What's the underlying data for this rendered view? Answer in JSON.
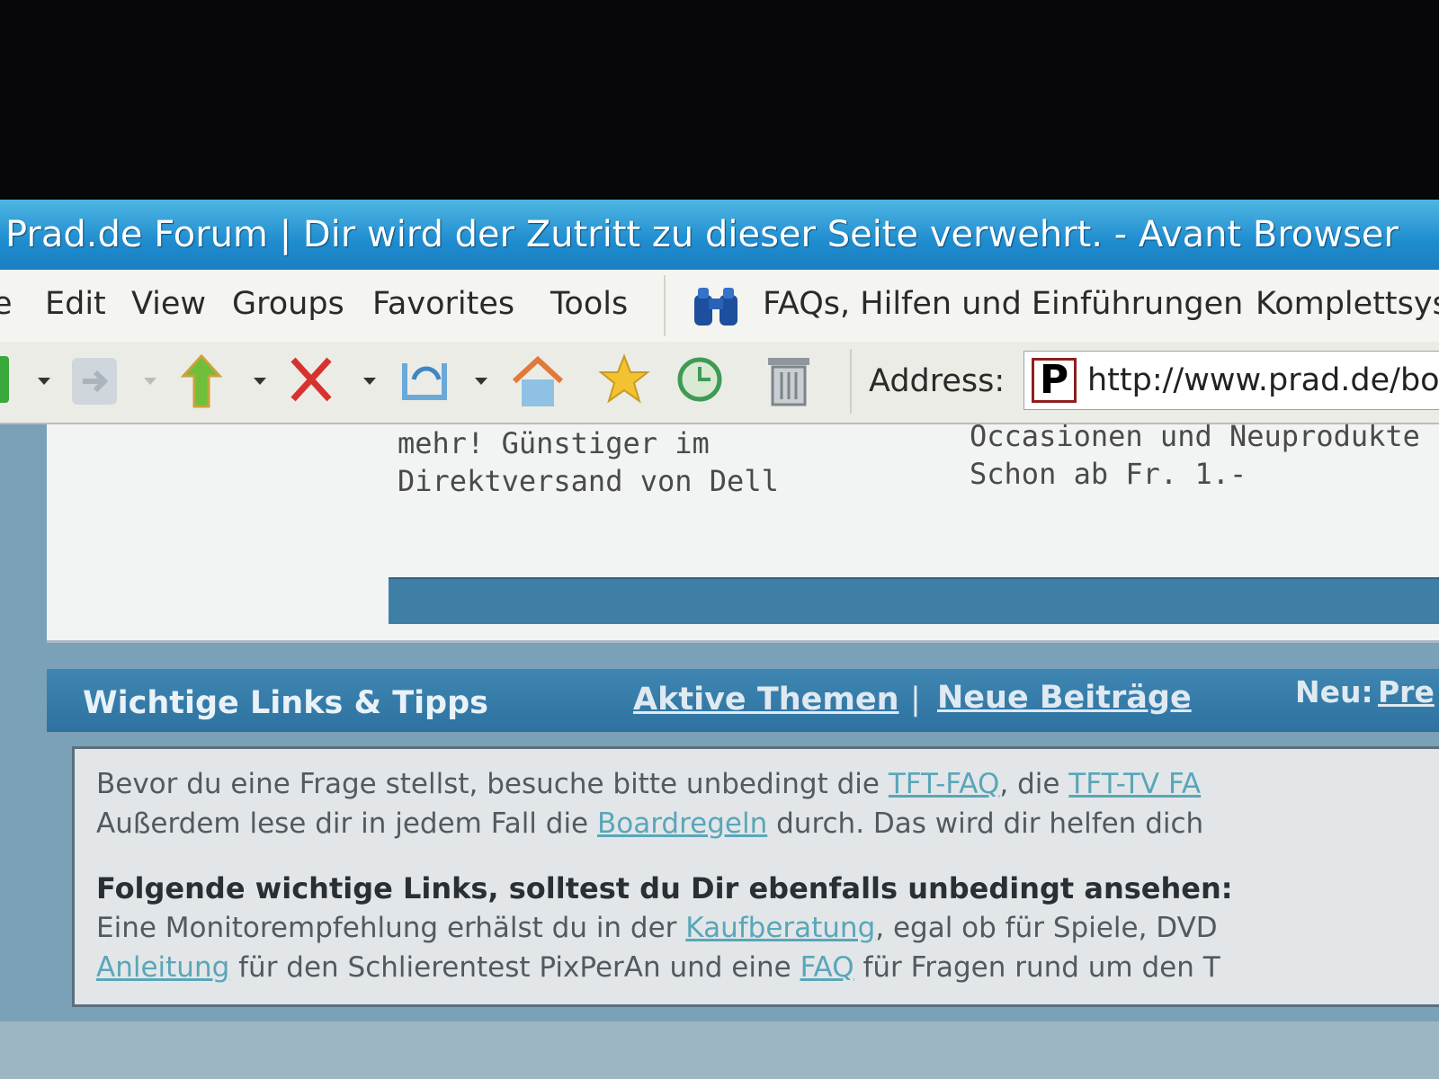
{
  "window": {
    "title": "Prad.de Forum | Dir wird der Zutritt zu dieser Seite verwehrt. - Avant Browser"
  },
  "menu": {
    "items": [
      "e",
      "Edit",
      "View",
      "Groups",
      "Favorites",
      "Tools"
    ],
    "links": {
      "faq": "FAQs, Hilfen und Einführungen",
      "komplett": "Komplettsyst"
    }
  },
  "toolbar": {
    "icons": [
      "back-icon",
      "forward-icon",
      "up-icon",
      "stop-icon",
      "undo-icon",
      "home-icon",
      "favorites-icon",
      "history-icon",
      "trash-icon"
    ],
    "address_label": "Address:",
    "address_url": "http://www.prad.de/boa"
  },
  "ad": {
    "left_line1": "mehr! Günstiger im",
    "left_line2": "Direktversand von Dell",
    "right_line1": "Occasionen und Neuprodukte",
    "right_line2": "Schon ab Fr. 1.-"
  },
  "section": {
    "title": "Wichtige Links & Tipps",
    "aktive": "Aktive Themen",
    "pipe": "|",
    "neue": "Neue Beiträge",
    "neu_label": "Neu:",
    "neu_link": "Pre"
  },
  "info": {
    "l1_a": "Bevor du eine Frage stellst, besuche bitte unbedingt die ",
    "l1_link1": "TFT-FAQ",
    "l1_b": ", die ",
    "l1_link2": "TFT-TV FA",
    "l2_a": "Außerdem lese dir in jedem Fall die ",
    "l2_link": "Boardregeln",
    "l2_b": " durch. Das wird dir helfen dich",
    "heading": "Folgende wichtige Links, solltest du Dir ebenfalls unbedingt ansehen:",
    "l4_a": "Eine Monitorempfehlung erhälst du in der ",
    "l4_link": "Kaufberatung",
    "l4_b": ", egal ob für Spiele, DVD",
    "l5_link1": "Anleitung",
    "l5_a": " für den Schlierentest PixPerAn und eine ",
    "l5_link2": "FAQ",
    "l5_b": " für Fragen rund um den T"
  }
}
